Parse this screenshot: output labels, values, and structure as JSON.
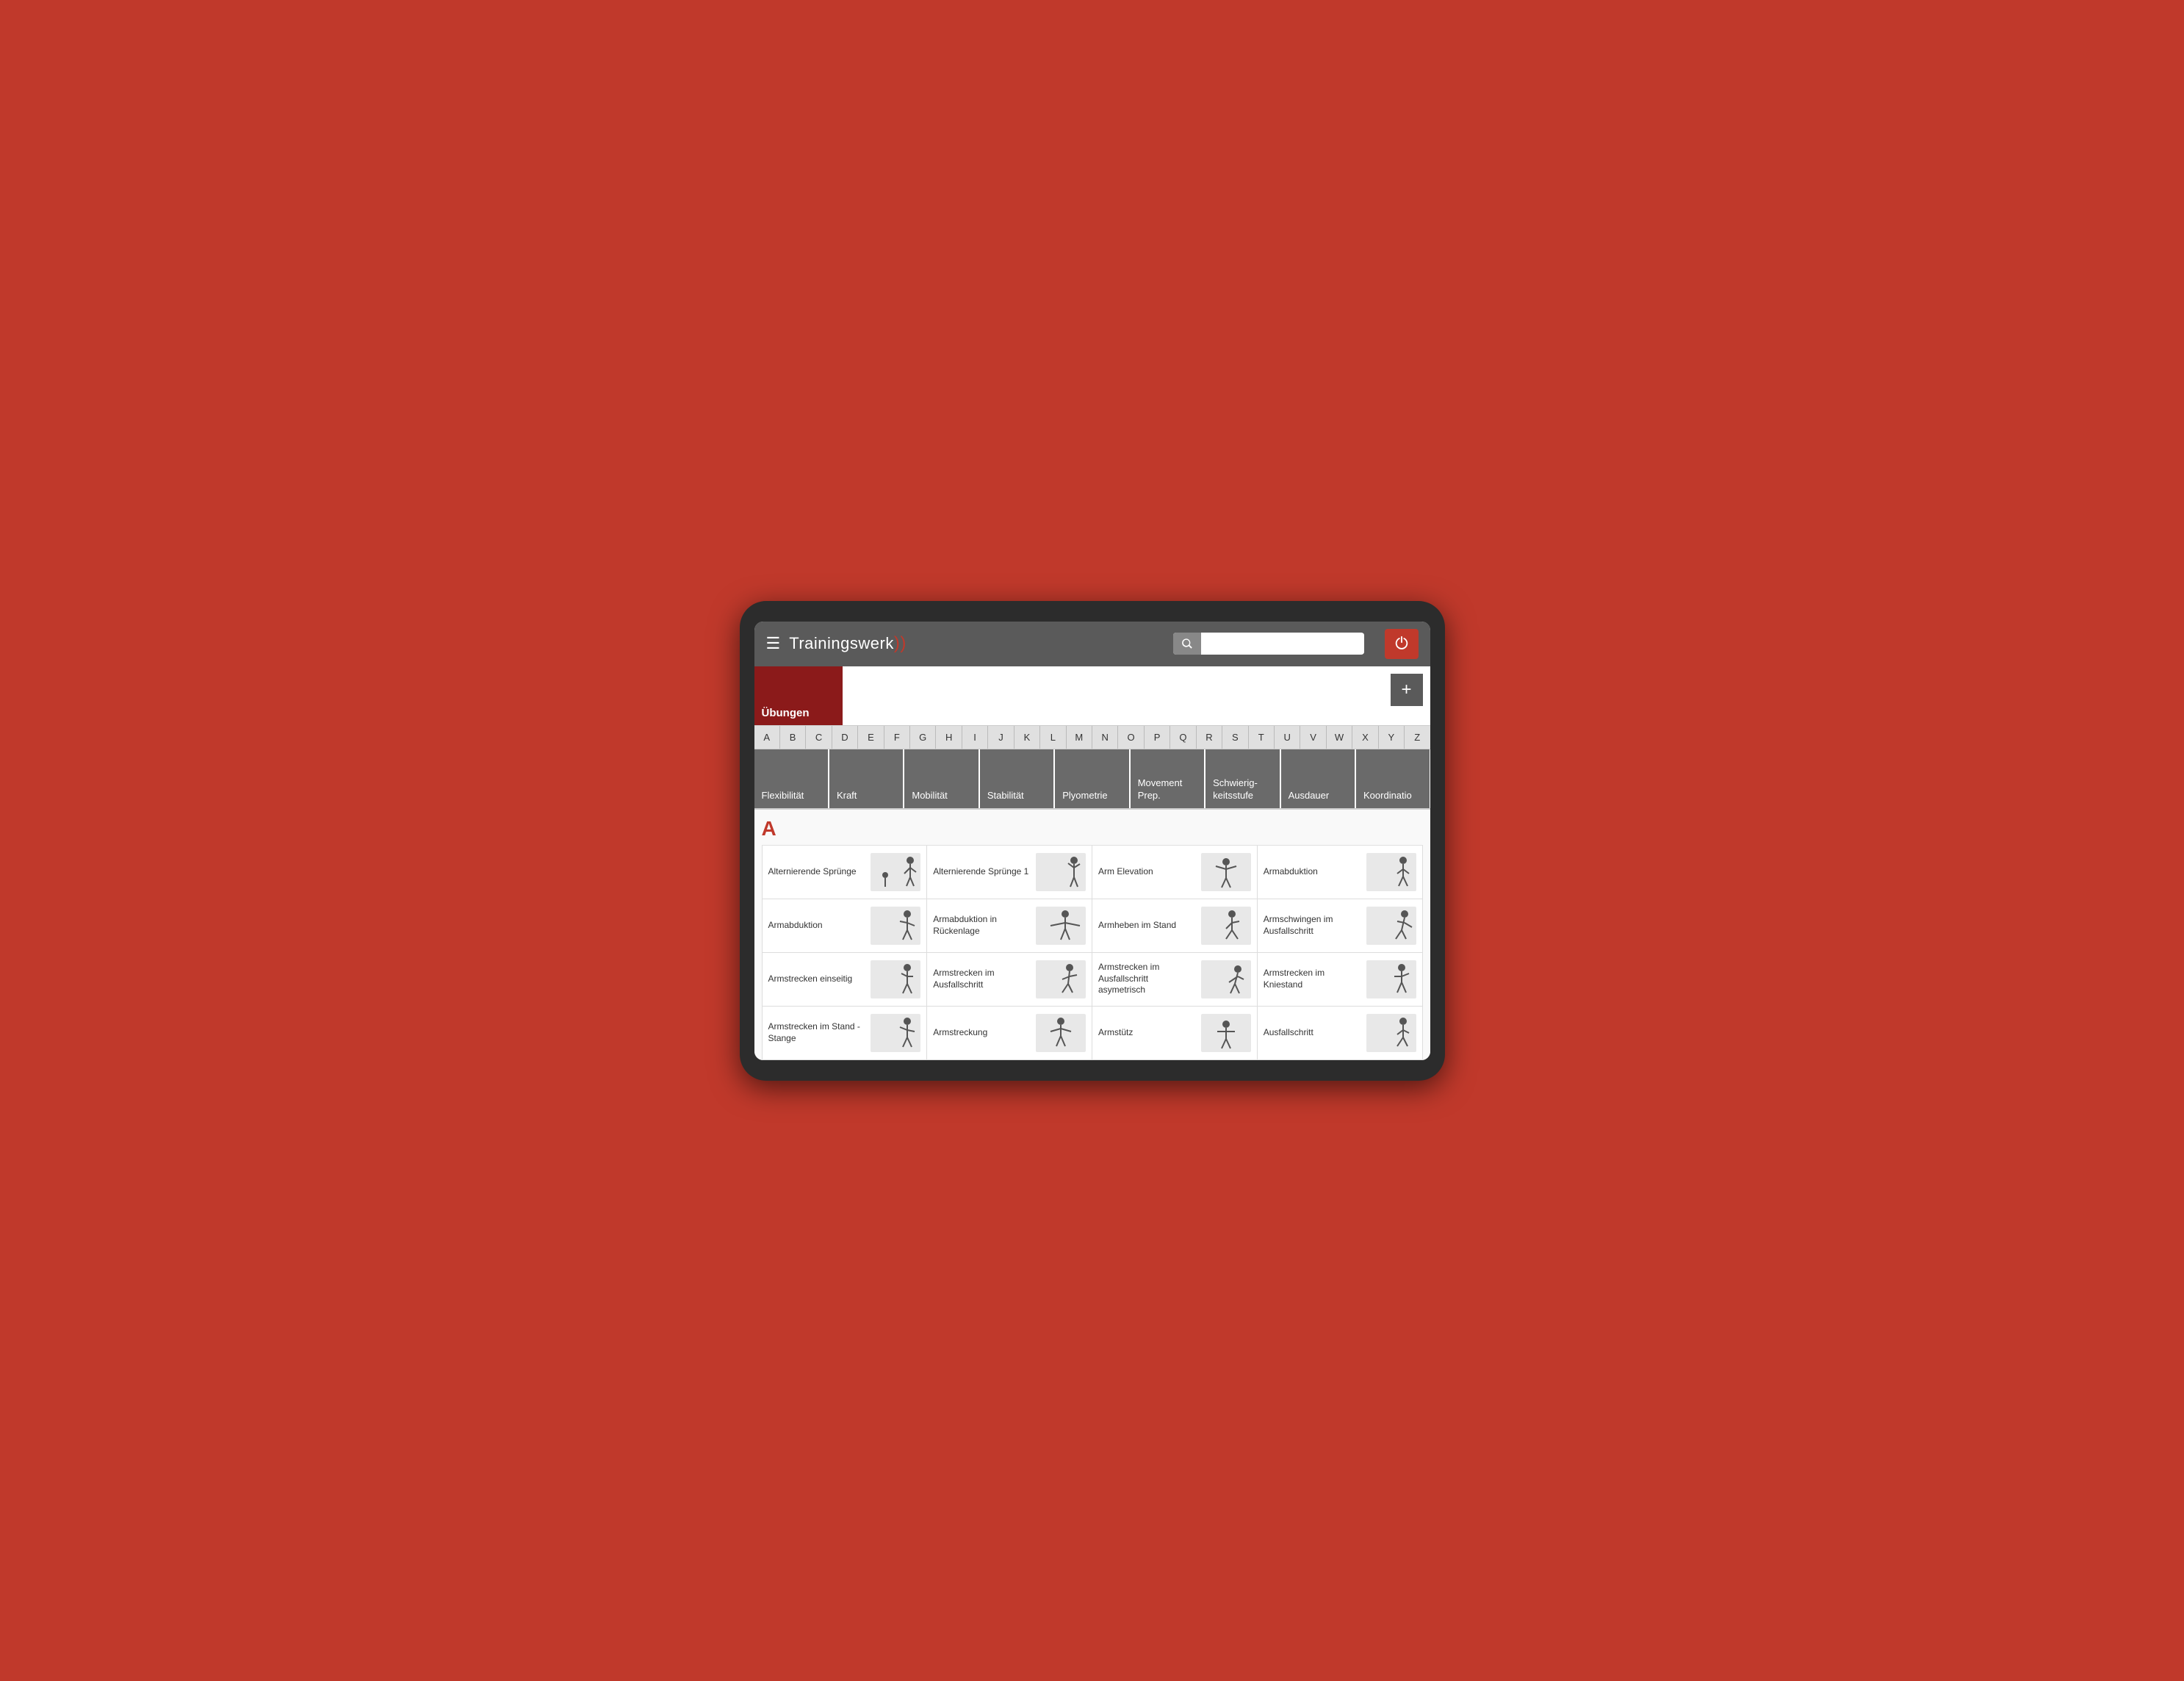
{
  "header": {
    "logo": "Trainingswerk",
    "search_placeholder": "",
    "power_label": "Power"
  },
  "category_block": {
    "label": "Übungen"
  },
  "add_button_label": "+",
  "alphabet": [
    "A",
    "B",
    "C",
    "D",
    "E",
    "F",
    "G",
    "H",
    "I",
    "J",
    "K",
    "L",
    "M",
    "N",
    "O",
    "P",
    "Q",
    "R",
    "S",
    "T",
    "U",
    "V",
    "W",
    "X",
    "Y",
    "Z"
  ],
  "filters": [
    {
      "label": "Flexibilität"
    },
    {
      "label": "Kraft"
    },
    {
      "label": "Mobilität"
    },
    {
      "label": "Stabilität"
    },
    {
      "label": "Plyometrie"
    },
    {
      "label": "Movement\nPrep."
    },
    {
      "label": "Schwierig-\nkeitsstufe"
    },
    {
      "label": "Ausdauer"
    },
    {
      "label": "Koordinatio"
    }
  ],
  "section": "A",
  "exercises": [
    {
      "name": "Alternierende Sprünge",
      "has_image": true
    },
    {
      "name": "Alternierende Sprünge 1",
      "has_image": true
    },
    {
      "name": "Arm Elevation",
      "has_image": true
    },
    {
      "name": "Armabduktion",
      "has_image": true
    },
    {
      "name": "Armabduktion",
      "has_image": true
    },
    {
      "name": "Armabduktion in Rückenlage",
      "has_image": true
    },
    {
      "name": "Armheben im Stand",
      "has_image": true
    },
    {
      "name": "Armschwingen im Ausfallschritt",
      "has_image": true
    },
    {
      "name": "Armstrecken einseitig",
      "has_image": true
    },
    {
      "name": "Armstrecken im Ausfallschritt",
      "has_image": true
    },
    {
      "name": "Armstrecken im Ausfallschritt asymetrisch",
      "has_image": true
    },
    {
      "name": "Armstrecken im Kniestand",
      "has_image": true
    },
    {
      "name": "Armstrecken im Stand - Stange",
      "has_image": true
    },
    {
      "name": "Armstreckung",
      "has_image": true
    },
    {
      "name": "Armstütz",
      "has_image": true
    },
    {
      "name": "Ausfallschritt",
      "has_image": true
    }
  ]
}
